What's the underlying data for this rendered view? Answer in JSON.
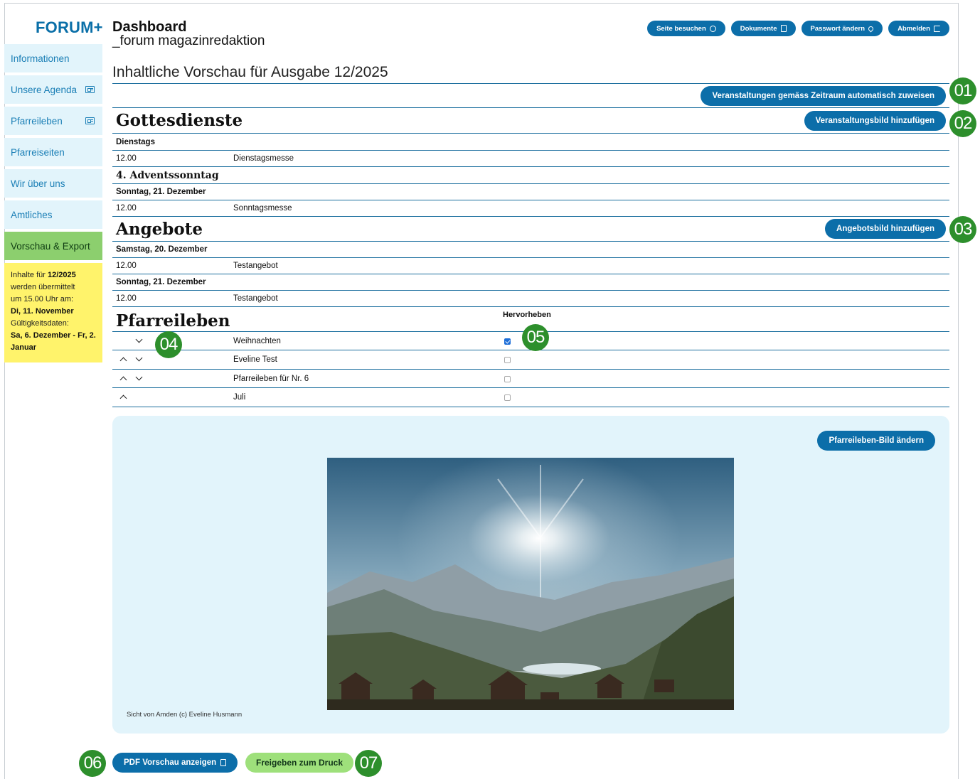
{
  "brand": {
    "logo": "FORUM+"
  },
  "header": {
    "title": "Dashboard",
    "subtitle": "_forum magazinredaktion",
    "buttons": [
      {
        "label": "Seite besuchen",
        "icon": "globe-icon"
      },
      {
        "label": "Dokumente",
        "icon": "document-icon"
      },
      {
        "label": "Passwort ändern",
        "icon": "key-icon"
      },
      {
        "label": "Abmelden",
        "icon": "logout-icon"
      }
    ]
  },
  "sidebar": {
    "items": [
      {
        "label": "Informationen",
        "icon": ""
      },
      {
        "label": "Unsere Agenda",
        "icon": "newspaper-icon"
      },
      {
        "label": "Pfarreileben",
        "icon": "newspaper-icon"
      },
      {
        "label": "Pfarreiseiten",
        "icon": ""
      },
      {
        "label": "Wir über uns",
        "icon": ""
      },
      {
        "label": "Amtliches",
        "icon": ""
      },
      {
        "label": "Vorschau & Export",
        "icon": "",
        "active": true
      }
    ],
    "info": {
      "l1": "Inhalte für ",
      "issue": "12/2025",
      "l2": "werden übermittelt",
      "l3": "um 15.00 Uhr am:",
      "date": "Di, 11. November",
      "l4": "Gültigkeitsdaten:",
      "range": "Sa, 6. Dezember - Fr, 2. Januar"
    }
  },
  "preview": {
    "heading": "Inhaltliche Vorschau für Ausgabe 12/2025",
    "assign_button": "Veranstaltungen gemäss Zeitraum automatisch zuweisen",
    "gottesdienste": {
      "title": "Gottesdienste",
      "add_image_button": "Veranstaltungsbild hinzufügen",
      "day1": "Dienstags",
      "row1": {
        "time": "12.00",
        "name": "Dienstagsmesse"
      },
      "occasion": "4. Adventssonntag",
      "day2": "Sonntag, 21. Dezember",
      "row2": {
        "time": "12.00",
        "name": "Sonntagsmesse"
      }
    },
    "angebote": {
      "title": "Angebote",
      "add_image_button": "Angebotsbild hinzufügen",
      "day1": "Samstag, 20. Dezember",
      "row1": {
        "time": "12.00",
        "name": "Testangebot"
      },
      "day2": "Sonntag, 21. Dezember",
      "row2": {
        "time": "12.00",
        "name": "Testangebot"
      }
    },
    "pfarreileben": {
      "title": "Pfarreileben",
      "highlight_header": "Hervorheben",
      "items": [
        {
          "name": "Weihnachten",
          "up": false,
          "down": true,
          "highlighted": true
        },
        {
          "name": "Eveline Test",
          "up": true,
          "down": true,
          "highlighted": false
        },
        {
          "name": "Pfarreileben für Nr. 6",
          "up": true,
          "down": true,
          "highlighted": false
        },
        {
          "name": "Juli",
          "up": true,
          "down": false,
          "highlighted": false
        }
      ],
      "change_image_button": "Pfarreileben-Bild ändern",
      "caption": "Sicht von Amden (c) Eveline Husmann"
    }
  },
  "footer": {
    "pdf_button": "PDF Vorschau anzeigen",
    "release_button": "Freigeben zum Druck"
  },
  "badges": [
    "01",
    "02",
    "03",
    "04",
    "05",
    "06",
    "07"
  ],
  "colors": {
    "primary": "#0c6ea9",
    "active_nav": "#8ccf6e",
    "nav_bg": "#e2f4fb",
    "info_bg": "#fff36b",
    "badge": "#2d8f2c",
    "release": "#9ee07b"
  }
}
